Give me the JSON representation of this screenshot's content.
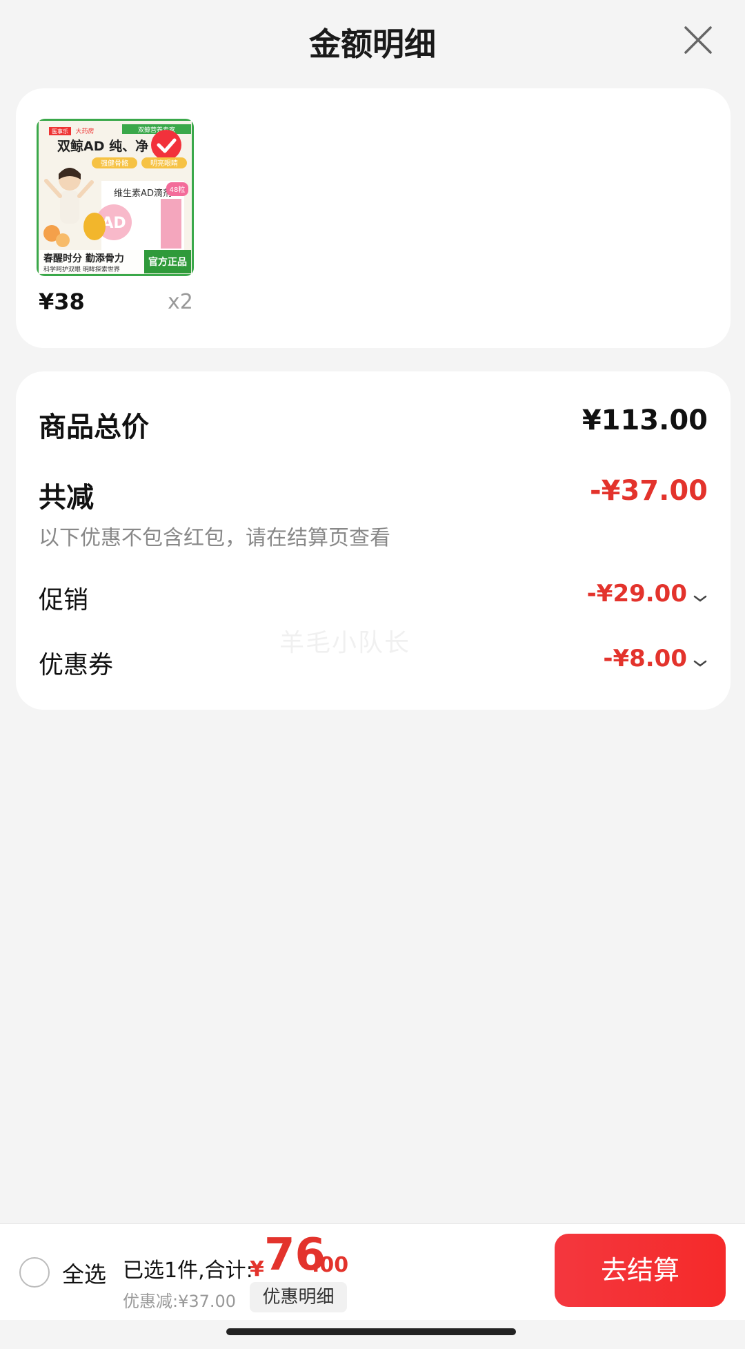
{
  "header": {
    "title": "金额明细"
  },
  "product": {
    "price": "¥38",
    "quantity": "x2",
    "image_texts": {
      "brand_badge": "医事乐",
      "brand_name": "大药房",
      "top_right_tag": "双鲸营养专家",
      "headline": "双鲸AD 纯、净",
      "benefit1": "强健骨骼",
      "benefit2": "明亮眼睛",
      "product_name": "维生素AD滴剂",
      "count_badge": "48粒",
      "slogan": "春醒时分 勤添骨力",
      "sub_slogan": "科学呵护双眼 明眸探索世界",
      "official_tag": "官方正品"
    }
  },
  "summary": {
    "total_label": "商品总价",
    "total_value": "¥113.00",
    "reduce_label": "共减",
    "reduce_value": "-¥37.00",
    "note": "以下优惠不包含红包，请在结算页查看",
    "promo_label": "促销",
    "promo_value": "-¥29.00",
    "coupon_label": "优惠券",
    "coupon_value": "-¥8.00"
  },
  "watermark": "羊毛小队长",
  "bottom_bar": {
    "select_all": "全选",
    "selected_text": "已选1件,合计:",
    "currency": "¥",
    "total_int": "76",
    "total_dec": ".00",
    "discount_text": "优惠减:¥37.00",
    "detail_button": "优惠明细",
    "checkout_button": "去结算"
  },
  "colors": {
    "accent_red": "#e3332c",
    "button_red": "#f4373e",
    "background": "#f4f4f4"
  }
}
